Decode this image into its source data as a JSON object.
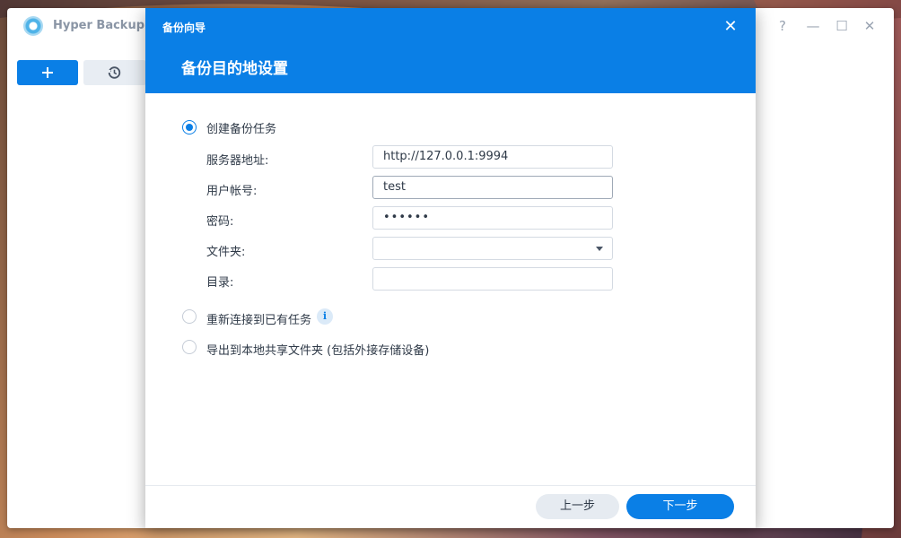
{
  "app": {
    "title": "Hyper Backup",
    "controls": {
      "help": "?",
      "minimize": "—",
      "maximize": "☐",
      "close": "✕"
    }
  },
  "dialog": {
    "caption": "备份向导",
    "title": "备份目的地设置",
    "close_glyph": "✕",
    "options": [
      {
        "label": "创建备份任务",
        "selected": true
      },
      {
        "label": "重新连接到已有任务",
        "selected": false
      },
      {
        "label": "导出到本地共享文件夹 (包括外接存储设备)",
        "selected": false
      }
    ],
    "fields": {
      "server_address": {
        "label": "服务器地址:",
        "value": "http://127.0.0.1:9994"
      },
      "user_account": {
        "label": "用户帐号:",
        "value": "test"
      },
      "password": {
        "label": "密码:",
        "value": "••••••"
      },
      "folder": {
        "label": "文件夹:",
        "value": ""
      },
      "directory": {
        "label": "目录:",
        "value": ""
      }
    },
    "info_glyph": "i",
    "buttons": {
      "prev": "上一步",
      "next": "下一步"
    }
  },
  "colors": {
    "accent": "#0a7fe6",
    "text": "#2f3a48",
    "muted": "#8a95a5"
  },
  "icons": [
    "hyper-backup-logo-icon",
    "plus-icon",
    "history-icon",
    "help-icon",
    "minimize-icon",
    "maximize-icon",
    "close-icon",
    "info-icon",
    "dropdown-caret-icon"
  ]
}
